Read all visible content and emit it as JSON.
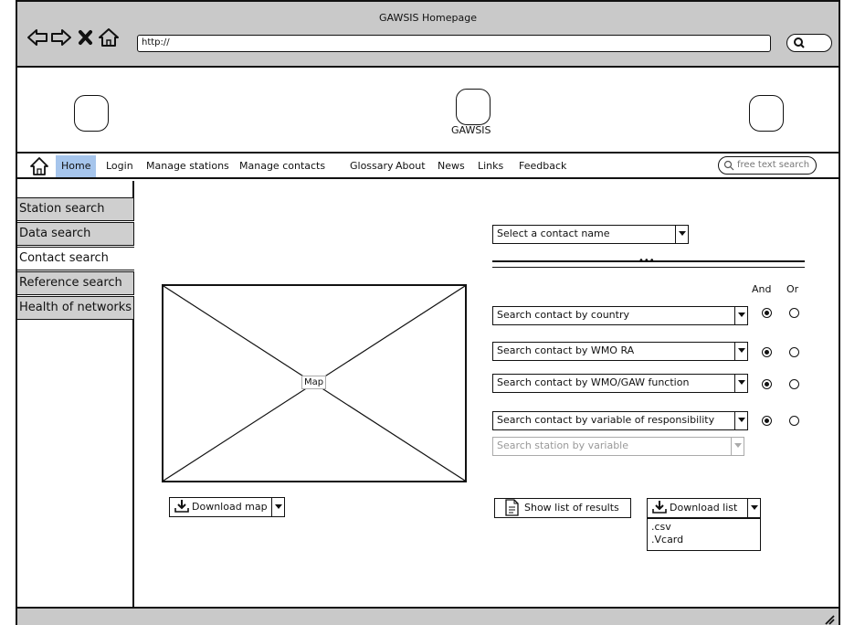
{
  "browser": {
    "title": "GAWSIS Homepage",
    "url": "http://"
  },
  "header": {
    "logo_center_label": "GAWSIS"
  },
  "nav": {
    "items": [
      "Home",
      "Login",
      "Manage stations",
      "Manage contacts",
      "Glossary",
      "About",
      "News",
      "Links",
      "Feedback"
    ],
    "active": "Home",
    "search_placeholder": "free text search"
  },
  "sidebar": {
    "items": [
      "Station search",
      "Data search",
      "Contact search",
      "Reference search",
      "Health of networks"
    ],
    "active": "Contact search"
  },
  "map": {
    "label": "Map",
    "download_button": "Download map"
  },
  "contact": {
    "select_name": "Select a contact name",
    "and_label": "And",
    "or_label": "Or",
    "filters": [
      {
        "label": "Search contact by country",
        "and": true
      },
      {
        "label": "Search contact by WMO RA",
        "and": true
      },
      {
        "label": "Search contact by WMO/GAW function",
        "and": true
      },
      {
        "label": "Search contact by variable of responsibility",
        "and": true
      }
    ],
    "station_by_variable": "Search station by variable",
    "show_list_button": "Show list of results",
    "download_list_button": "Download list",
    "download_options": [
      ".csv",
      ".Vcard"
    ]
  }
}
